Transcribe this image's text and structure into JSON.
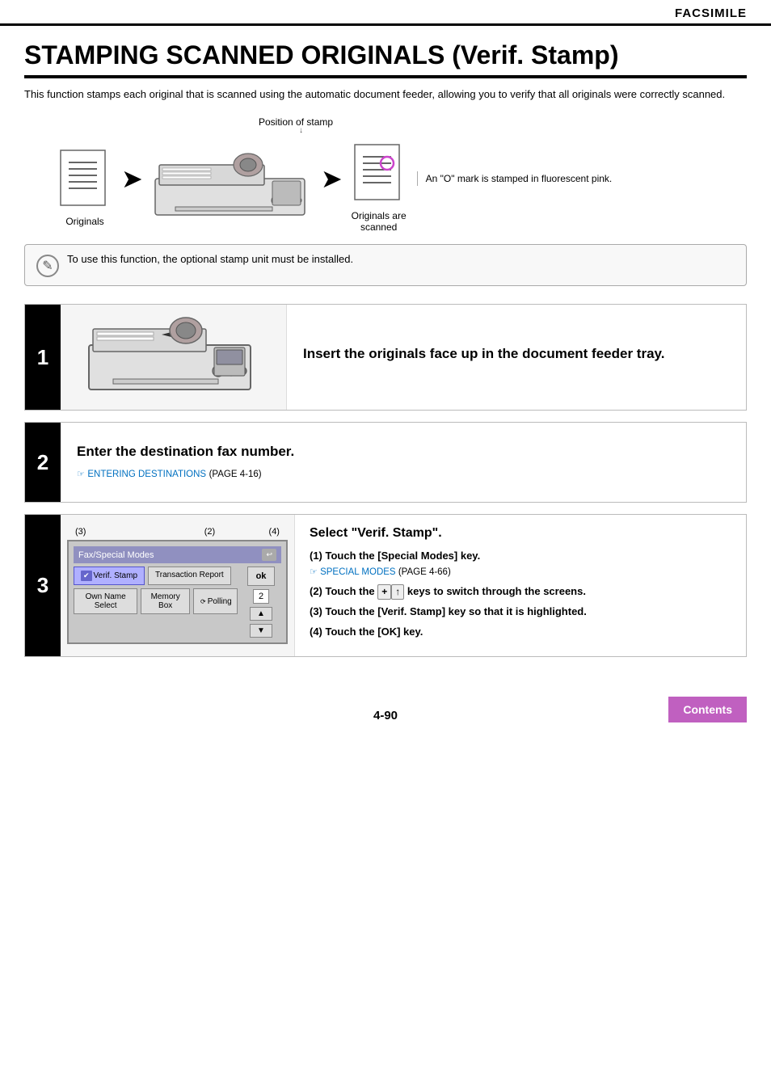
{
  "header": {
    "title": "FACSIMILE"
  },
  "page": {
    "heading": "STAMPING SCANNED ORIGINALS (Verif. Stamp)",
    "intro": "This function stamps each original that is scanned using the automatic document feeder, allowing you to verify that all originals were correctly scanned."
  },
  "diagram": {
    "stamp_position_label": "Position of stamp",
    "originals_label": "Originals",
    "originals_scanned_label": "Originals are scanned",
    "annotation": "An \"O\" mark is stamped in fluorescent pink."
  },
  "note": {
    "text": "To use this function, the optional stamp unit must be installed."
  },
  "steps": [
    {
      "number": "1",
      "title": "Insert the originals face up in the document feeder tray.",
      "sub_ref": ""
    },
    {
      "number": "2",
      "title": "Enter the destination fax number.",
      "sub_ref": "ENTERING DESTINATIONS",
      "sub_page": "(page 4-16)"
    },
    {
      "number": "3",
      "title": "Select \"Verif. Stamp\".",
      "sub_items": [
        {
          "num": "(1)",
          "text": "Touch the [Special Modes] key.",
          "ref": "SPECIAL MODES",
          "ref_page": "(page 4-66)"
        },
        {
          "num": "(2)",
          "text": "Touch the  keys to switch through the screens."
        },
        {
          "num": "(3)",
          "text": "Touch the [Verif. Stamp] key so that it is highlighted."
        },
        {
          "num": "(4)",
          "text": "Touch the [OK] key."
        }
      ],
      "ui": {
        "top_bar_label": "Fax/Special Modes",
        "callouts": [
          "(3)",
          "(2)",
          "(4)"
        ],
        "verif_stamp_btn": "Verif.\nStamp",
        "transaction_report_btn": "Transaction\nReport",
        "own_name_select_btn": "Own Name\nSelect",
        "memory_box_btn": "Memory Box",
        "polling_btn": "Polling",
        "num_display": "2",
        "ok_btn": "ok"
      }
    }
  ],
  "footer": {
    "page_number": "4-90",
    "contents_btn": "Contents"
  }
}
